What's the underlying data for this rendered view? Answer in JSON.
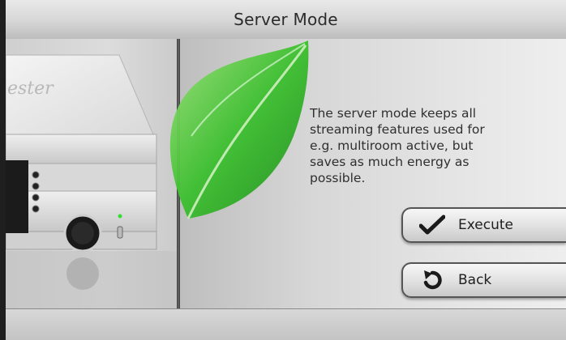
{
  "header": {
    "title": "Server Mode"
  },
  "main": {
    "description": [
      "The server mode keeps all",
      "streaming features used for",
      "e.g. multiroom active, but",
      "saves as much energy as",
      "possible."
    ],
    "device_brand": "ester"
  },
  "buttons": {
    "execute": {
      "label": "Execute",
      "icon": "checkmark-icon"
    },
    "back": {
      "label": "Back",
      "icon": "back-arrow-icon"
    }
  },
  "colors": {
    "leaf_green": "#3cbf2f",
    "status_led": "#33dd33"
  }
}
